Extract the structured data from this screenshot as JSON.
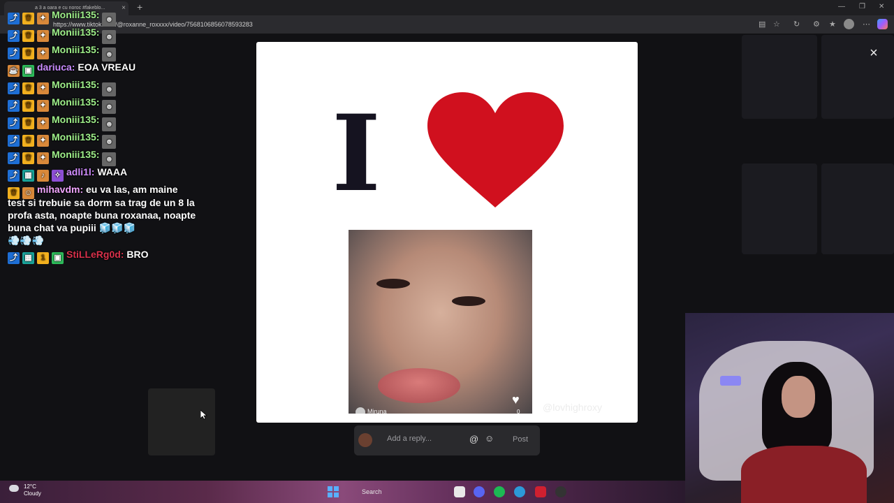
{
  "browser": {
    "tab_title": "a 3 a oara e cu noroc #fakeblo...",
    "url": "https://www.tiktok.com/@roxanne_roxxxx/video/7568106856078593283",
    "tab_close": "×",
    "new_tab": "+"
  },
  "chat": {
    "messages": [
      {
        "user": "Moniii135:",
        "text": ""
      },
      {
        "user": "Moniii135:",
        "text": ""
      },
      {
        "user": "Moniii135:",
        "text": ""
      },
      {
        "user": "dariuca:",
        "text": "EOA VREAU"
      },
      {
        "user": "Moniii135:",
        "text": ""
      },
      {
        "user": "Moniii135:",
        "text": ""
      },
      {
        "user": "Moniii135:",
        "text": ""
      },
      {
        "user": "Moniii135:",
        "text": ""
      },
      {
        "user": "Moniii135:",
        "text": ""
      },
      {
        "user": "adli1l:",
        "text": "WAAA"
      },
      {
        "user": "mihavdm:",
        "text": "eu va las, am maine"
      },
      {
        "user": "StiLLeRg0d:",
        "text": "BRO"
      }
    ],
    "multiline_rest": "test si trebuie sa dorm sa trag de un 8 la profa asta, noapte buna roxanaa, noapte buna chat va pupiii"
  },
  "modal": {
    "big_letter": "I",
    "video_user": "Miruna",
    "like_count": "0",
    "watermark": "@lovhighroxy",
    "close_label": "×"
  },
  "reply": {
    "placeholder": "Add a reply...",
    "at_symbol": "@",
    "emoji_symbol": "☺",
    "post_label": "Post"
  },
  "taskbar": {
    "temperature": "12°C",
    "condition": "Cloudy",
    "search_label": "Search"
  },
  "colors": {
    "heart": "#d0101e",
    "letter": "#151320"
  }
}
